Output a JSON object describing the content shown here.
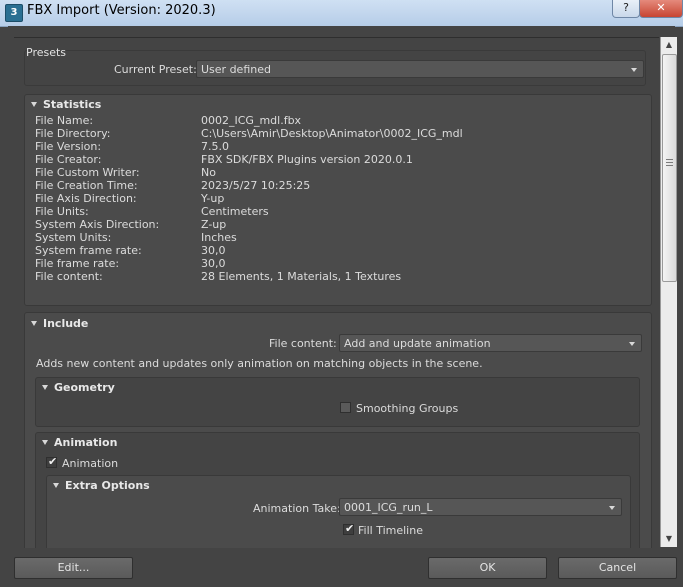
{
  "window": {
    "title": "FBX Import (Version: 2020.3)",
    "app_icon": "3",
    "help": "?",
    "close": "✕"
  },
  "presets": {
    "group_label": "Presets",
    "current_preset_label": "Current Preset:",
    "current_preset_value": "User defined"
  },
  "statistics": {
    "title": "Statistics",
    "rows": [
      {
        "k": "File Name:",
        "v": "0002_ICG_mdl.fbx"
      },
      {
        "k": "File Directory:",
        "v": "C:\\Users\\Amir\\Desktop\\Animator\\0002_ICG_mdl"
      },
      {
        "k": "File Version:",
        "v": "7.5.0"
      },
      {
        "k": "File Creator:",
        "v": "FBX SDK/FBX Plugins version 2020.0.1"
      },
      {
        "k": "File Custom Writer:",
        "v": "No"
      },
      {
        "k": "File Creation Time:",
        "v": "2023/5/27  10:25:25"
      },
      {
        "k": "File Axis Direction:",
        "v": "Y-up"
      },
      {
        "k": "File Units:",
        "v": "Centimeters"
      },
      {
        "k": "System Axis Direction:",
        "v": "Z-up"
      },
      {
        "k": "System Units:",
        "v": "Inches"
      },
      {
        "k": "System frame rate:",
        "v": "30,0"
      },
      {
        "k": "File frame rate:",
        "v": "30,0"
      },
      {
        "k": "File content:",
        "v": "28 Elements,    1 Materials,    1 Textures"
      }
    ]
  },
  "include": {
    "title": "Include",
    "file_content_label": "File content:",
    "file_content_value": "Add and update animation",
    "description": "Adds new content and updates only animation on matching objects in the scene.",
    "geometry": {
      "title": "Geometry",
      "smoothing_groups": "Smoothing Groups",
      "smoothing_checked": false
    },
    "animation": {
      "title": "Animation",
      "animation_label": "Animation",
      "animation_checked": true,
      "extra_options": {
        "title": "Extra Options",
        "take_label": "Animation Take:",
        "take_value": "0001_ICG_run_L",
        "fill_timeline": "Fill Timeline",
        "fill_checked": true
      }
    }
  },
  "buttons": {
    "edit": "Edit...",
    "ok": "OK",
    "cancel": "Cancel"
  },
  "colors": {
    "background": "#444444",
    "panel": "#4b4b4b",
    "text": "#dcdcdc"
  }
}
